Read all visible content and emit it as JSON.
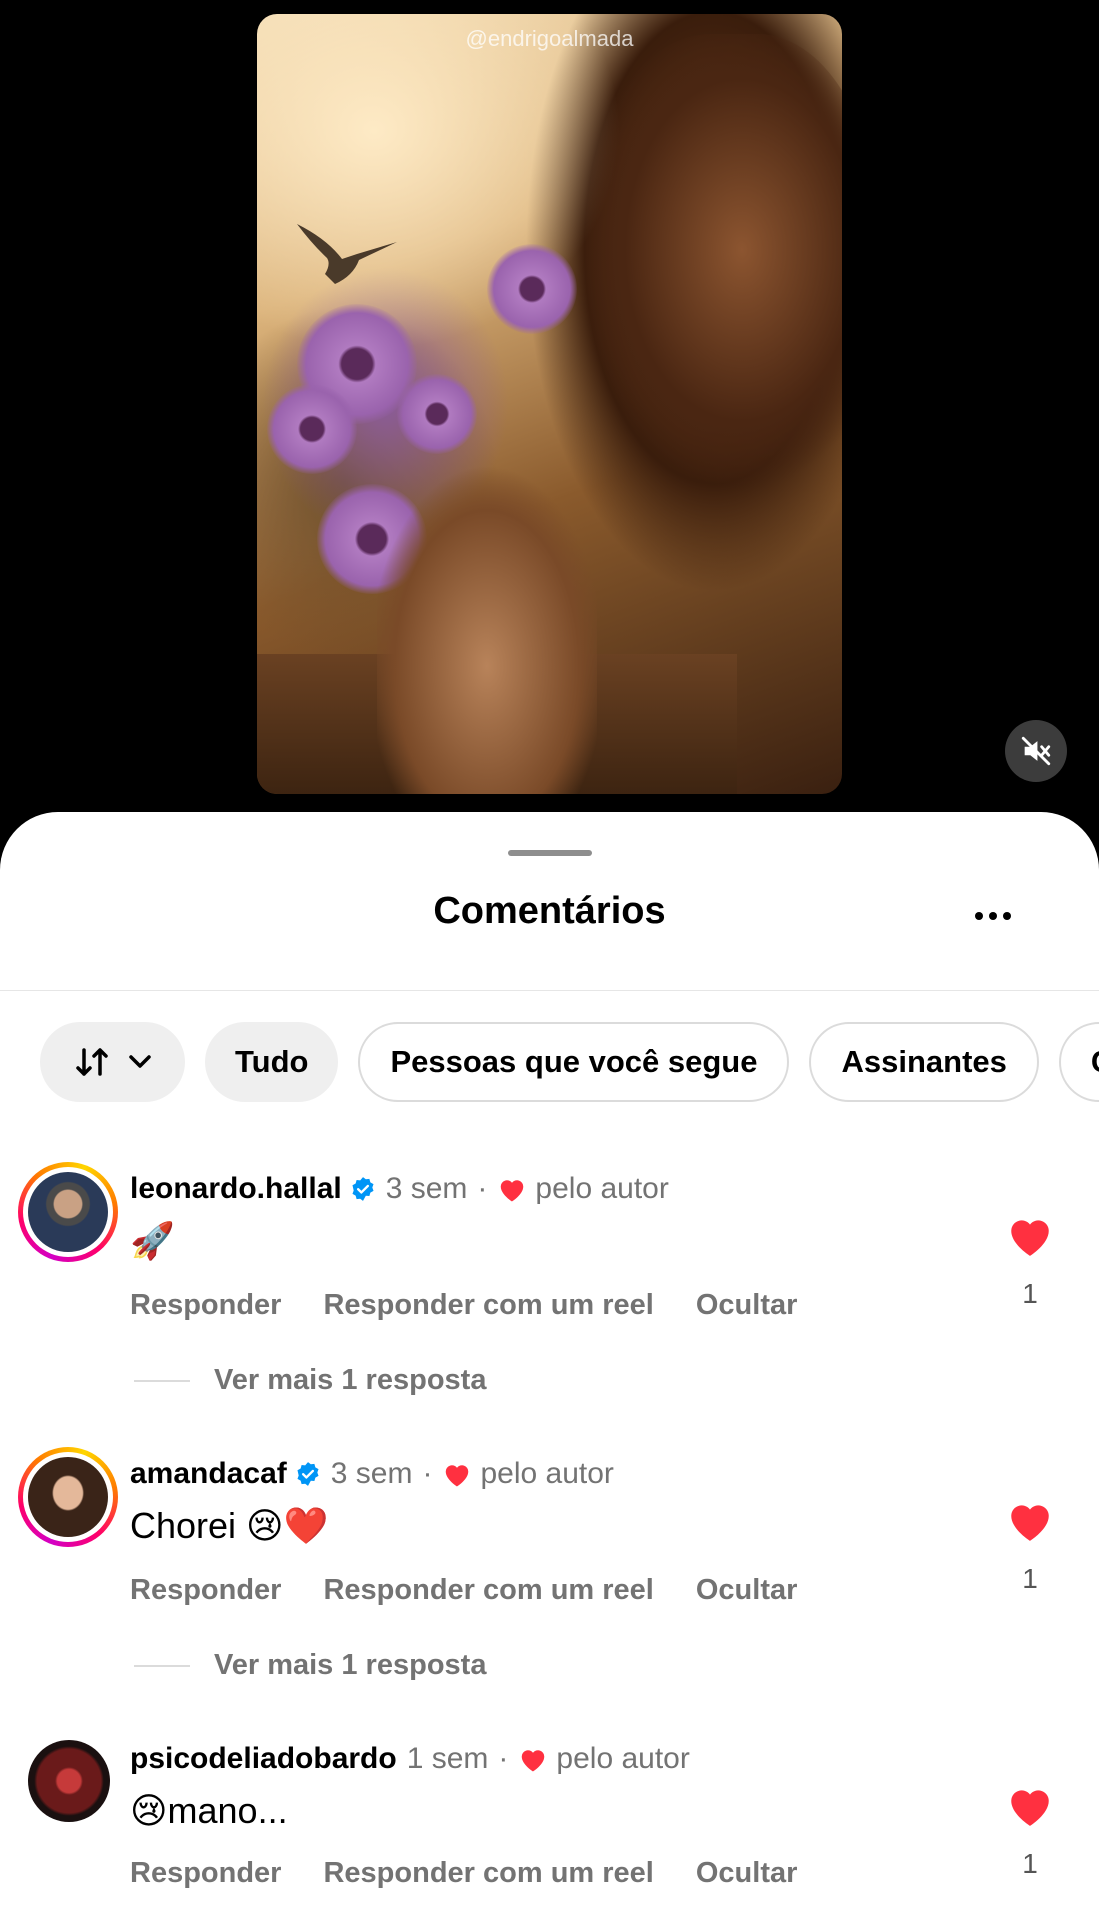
{
  "video": {
    "watermark": "@endrigoalmada",
    "mute_icon": "speaker-muted-icon"
  },
  "sheet": {
    "title": "Comentários",
    "more_icon": "more-horizontal-icon"
  },
  "filters": {
    "sort_icon": "sort-arrows-icon",
    "chips": [
      "Tudo",
      "Pessoas que você segue",
      "Assinantes",
      "Co"
    ]
  },
  "comments": [
    {
      "username": "leonardo.hallal",
      "verified": true,
      "time": "3 sem",
      "liked_by_author": "pelo autor",
      "text": "🚀",
      "actions": [
        "Responder",
        "Responder com um reel",
        "Ocultar"
      ],
      "likes": "1",
      "replies_link": "Ver mais 1 resposta"
    },
    {
      "username": "amandacaf",
      "verified": true,
      "time": "3 sem",
      "liked_by_author": "pelo autor",
      "text": "Chorei 😢❤️",
      "actions": [
        "Responder",
        "Responder com um reel",
        "Ocultar"
      ],
      "likes": "1",
      "replies_link": "Ver mais 1 resposta"
    },
    {
      "username": "psicodeliadobardo",
      "verified": false,
      "time": "1 sem",
      "liked_by_author": "pelo autor",
      "text": "😢mano...",
      "actions": [
        "Responder",
        "Responder com um reel",
        "Ocultar"
      ],
      "likes": "1"
    }
  ],
  "colors": {
    "like_red": "#ff3040",
    "verified_blue": "#0095f6",
    "secondary_text": "#737373"
  }
}
